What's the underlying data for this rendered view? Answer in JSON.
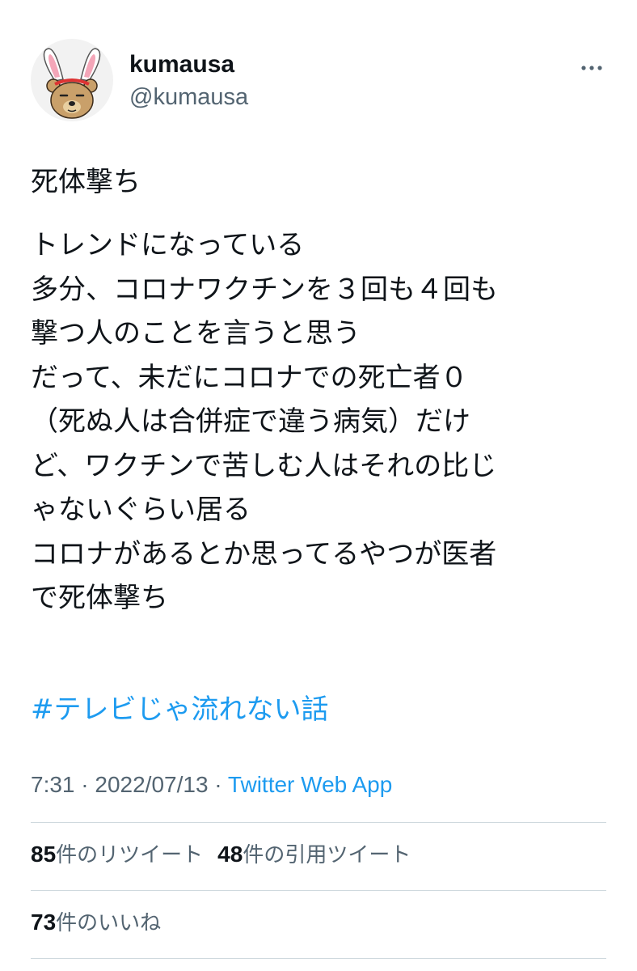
{
  "user": {
    "display_name": "kumausa",
    "handle": "@kumausa",
    "avatar_icon": "bear-with-bunny-ears-avatar"
  },
  "more_icon": "more-horizontal-icon",
  "tweet": {
    "title": "死体撃ち",
    "lines": [
      "トレンドになっている",
      "多分、コロナワクチンを３回も４回も",
      "撃つ人のことを言うと思う",
      "だって、未だにコロナでの死亡者０",
      "（死ぬ人は合併症で違う病気）だけ",
      "ど、ワクチンで苦しむ人はそれの比じ",
      "ゃないぐらい居る",
      "コロナがあるとか思ってるやつが医者",
      "で死体撃ち"
    ],
    "hashtag": "#テレビじゃ流れない話"
  },
  "meta": {
    "time": "7:31",
    "separator1": " · ",
    "date": "2022/07/13",
    "separator2": " · ",
    "app": "Twitter Web App"
  },
  "stats": {
    "retweets": {
      "count": "85",
      "label": "件のリツイート"
    },
    "quotes": {
      "count": "48",
      "label": "件の引用ツイート"
    },
    "likes": {
      "count": "73",
      "label": "件のいいね"
    }
  },
  "colors": {
    "text": "#0f1419",
    "secondary": "#536471",
    "link": "#1d9bf0",
    "divider": "#cfd9de"
  }
}
